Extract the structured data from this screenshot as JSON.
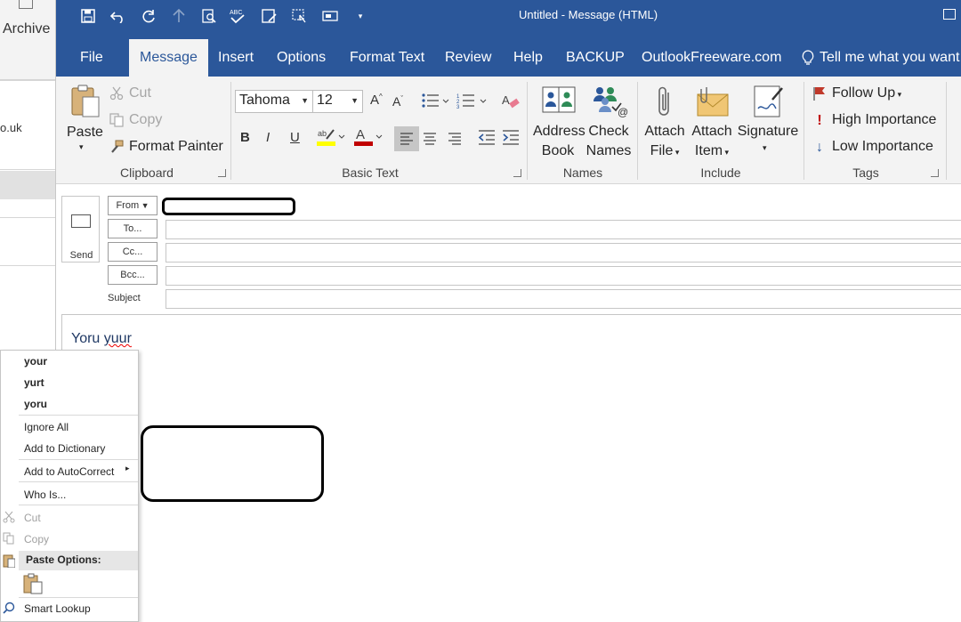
{
  "window": {
    "title": "Untitled  -  Message (HTML)"
  },
  "background": {
    "archive_label": "Archive",
    "partial_text": "o.uk"
  },
  "tabs": [
    {
      "label": "File"
    },
    {
      "label": "Message"
    },
    {
      "label": "Insert"
    },
    {
      "label": "Options"
    },
    {
      "label": "Format Text"
    },
    {
      "label": "Review"
    },
    {
      "label": "Help"
    },
    {
      "label": "BACKUP"
    },
    {
      "label": "OutlookFreeware.com"
    },
    {
      "label": "Tell me what you want"
    }
  ],
  "ribbon": {
    "clipboard": {
      "paste": "Paste",
      "cut": "Cut",
      "copy": "Copy",
      "format_painter": "Format Painter",
      "label": "Clipboard"
    },
    "basic_text": {
      "font": "Tahoma",
      "size": "12",
      "bold": "B",
      "italic": "I",
      "underline": "U",
      "label": "Basic Text"
    },
    "names": {
      "address_book_1": "Address",
      "address_book_2": "Book",
      "check_names_1": "Check",
      "check_names_2": "Names",
      "label": "Names"
    },
    "include": {
      "attach_file_1": "Attach",
      "attach_file_2": "File",
      "attach_item_1": "Attach",
      "attach_item_2": "Item",
      "signature": "Signature",
      "label": "Include"
    },
    "tags": {
      "follow_up": "Follow Up",
      "high_importance": "High Importance",
      "low_importance": "Low Importance",
      "label": "Tags"
    }
  },
  "compose": {
    "send": "Send",
    "from": "From",
    "to": "To...",
    "cc": "Cc...",
    "bcc": "Bcc...",
    "subject_label": "Subject",
    "body_text_1": "Yoru ",
    "body_text_2": "yuur"
  },
  "context_menu": {
    "suggestions": [
      "your",
      "yurt",
      "yoru"
    ],
    "ignore_all": "Ignore All",
    "add_to_dictionary": "Add to Dictionary",
    "add_to_autocorrect": "Add to AutoCorrect",
    "who_is": "Who Is...",
    "cut": "Cut",
    "copy": "Copy",
    "paste_options": "Paste Options:",
    "smart_lookup": "Smart Lookup"
  },
  "colors": {
    "accent": "#2b579a",
    "ribbon_bg": "#f3f3f3"
  }
}
